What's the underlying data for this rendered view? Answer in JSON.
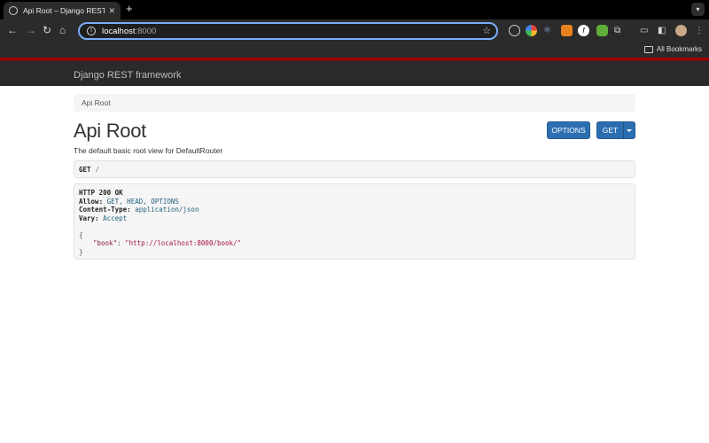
{
  "browser": {
    "tab_title": "Api Root – Django REST fram",
    "new_tab_label": "+",
    "url_host": "localhost",
    "url_port": ":8000",
    "bookmarks_label": "All Bookmarks",
    "icons": [
      "back-arrow-icon",
      "forward-arrow-icon",
      "reload-icon",
      "home-icon",
      "info-icon",
      "star-icon",
      "extensions-icon",
      "cast-icon",
      "sidebar-icon",
      "profile-avatar",
      "more-icon"
    ]
  },
  "navbar": {
    "brand": "Django REST framework"
  },
  "breadcrumb": {
    "item": "Api Root"
  },
  "main": {
    "title": "Api Root",
    "description": "The default basic root view for DefaultRouter",
    "options_label": "OPTIONS",
    "get_label": "GET"
  },
  "request": {
    "method": "GET",
    "path": "/"
  },
  "response": {
    "status": "HTTP 200 OK",
    "headers": [
      {
        "name": "Allow:",
        "value": "GET, HEAD, OPTIONS"
      },
      {
        "name": "Content-Type:",
        "value": "application/json"
      },
      {
        "name": "Vary:",
        "value": "Accept"
      }
    ],
    "open_brace": "{",
    "close_brace": "}",
    "body_key": "\"book\"",
    "body_colon": ": ",
    "body_value": "\"http://localhost:8000/book/\""
  },
  "colors": {
    "navbar_bg": "#2a2a2a",
    "navbar_accent": "#a30000",
    "button_primary": "#2c6fb0"
  }
}
